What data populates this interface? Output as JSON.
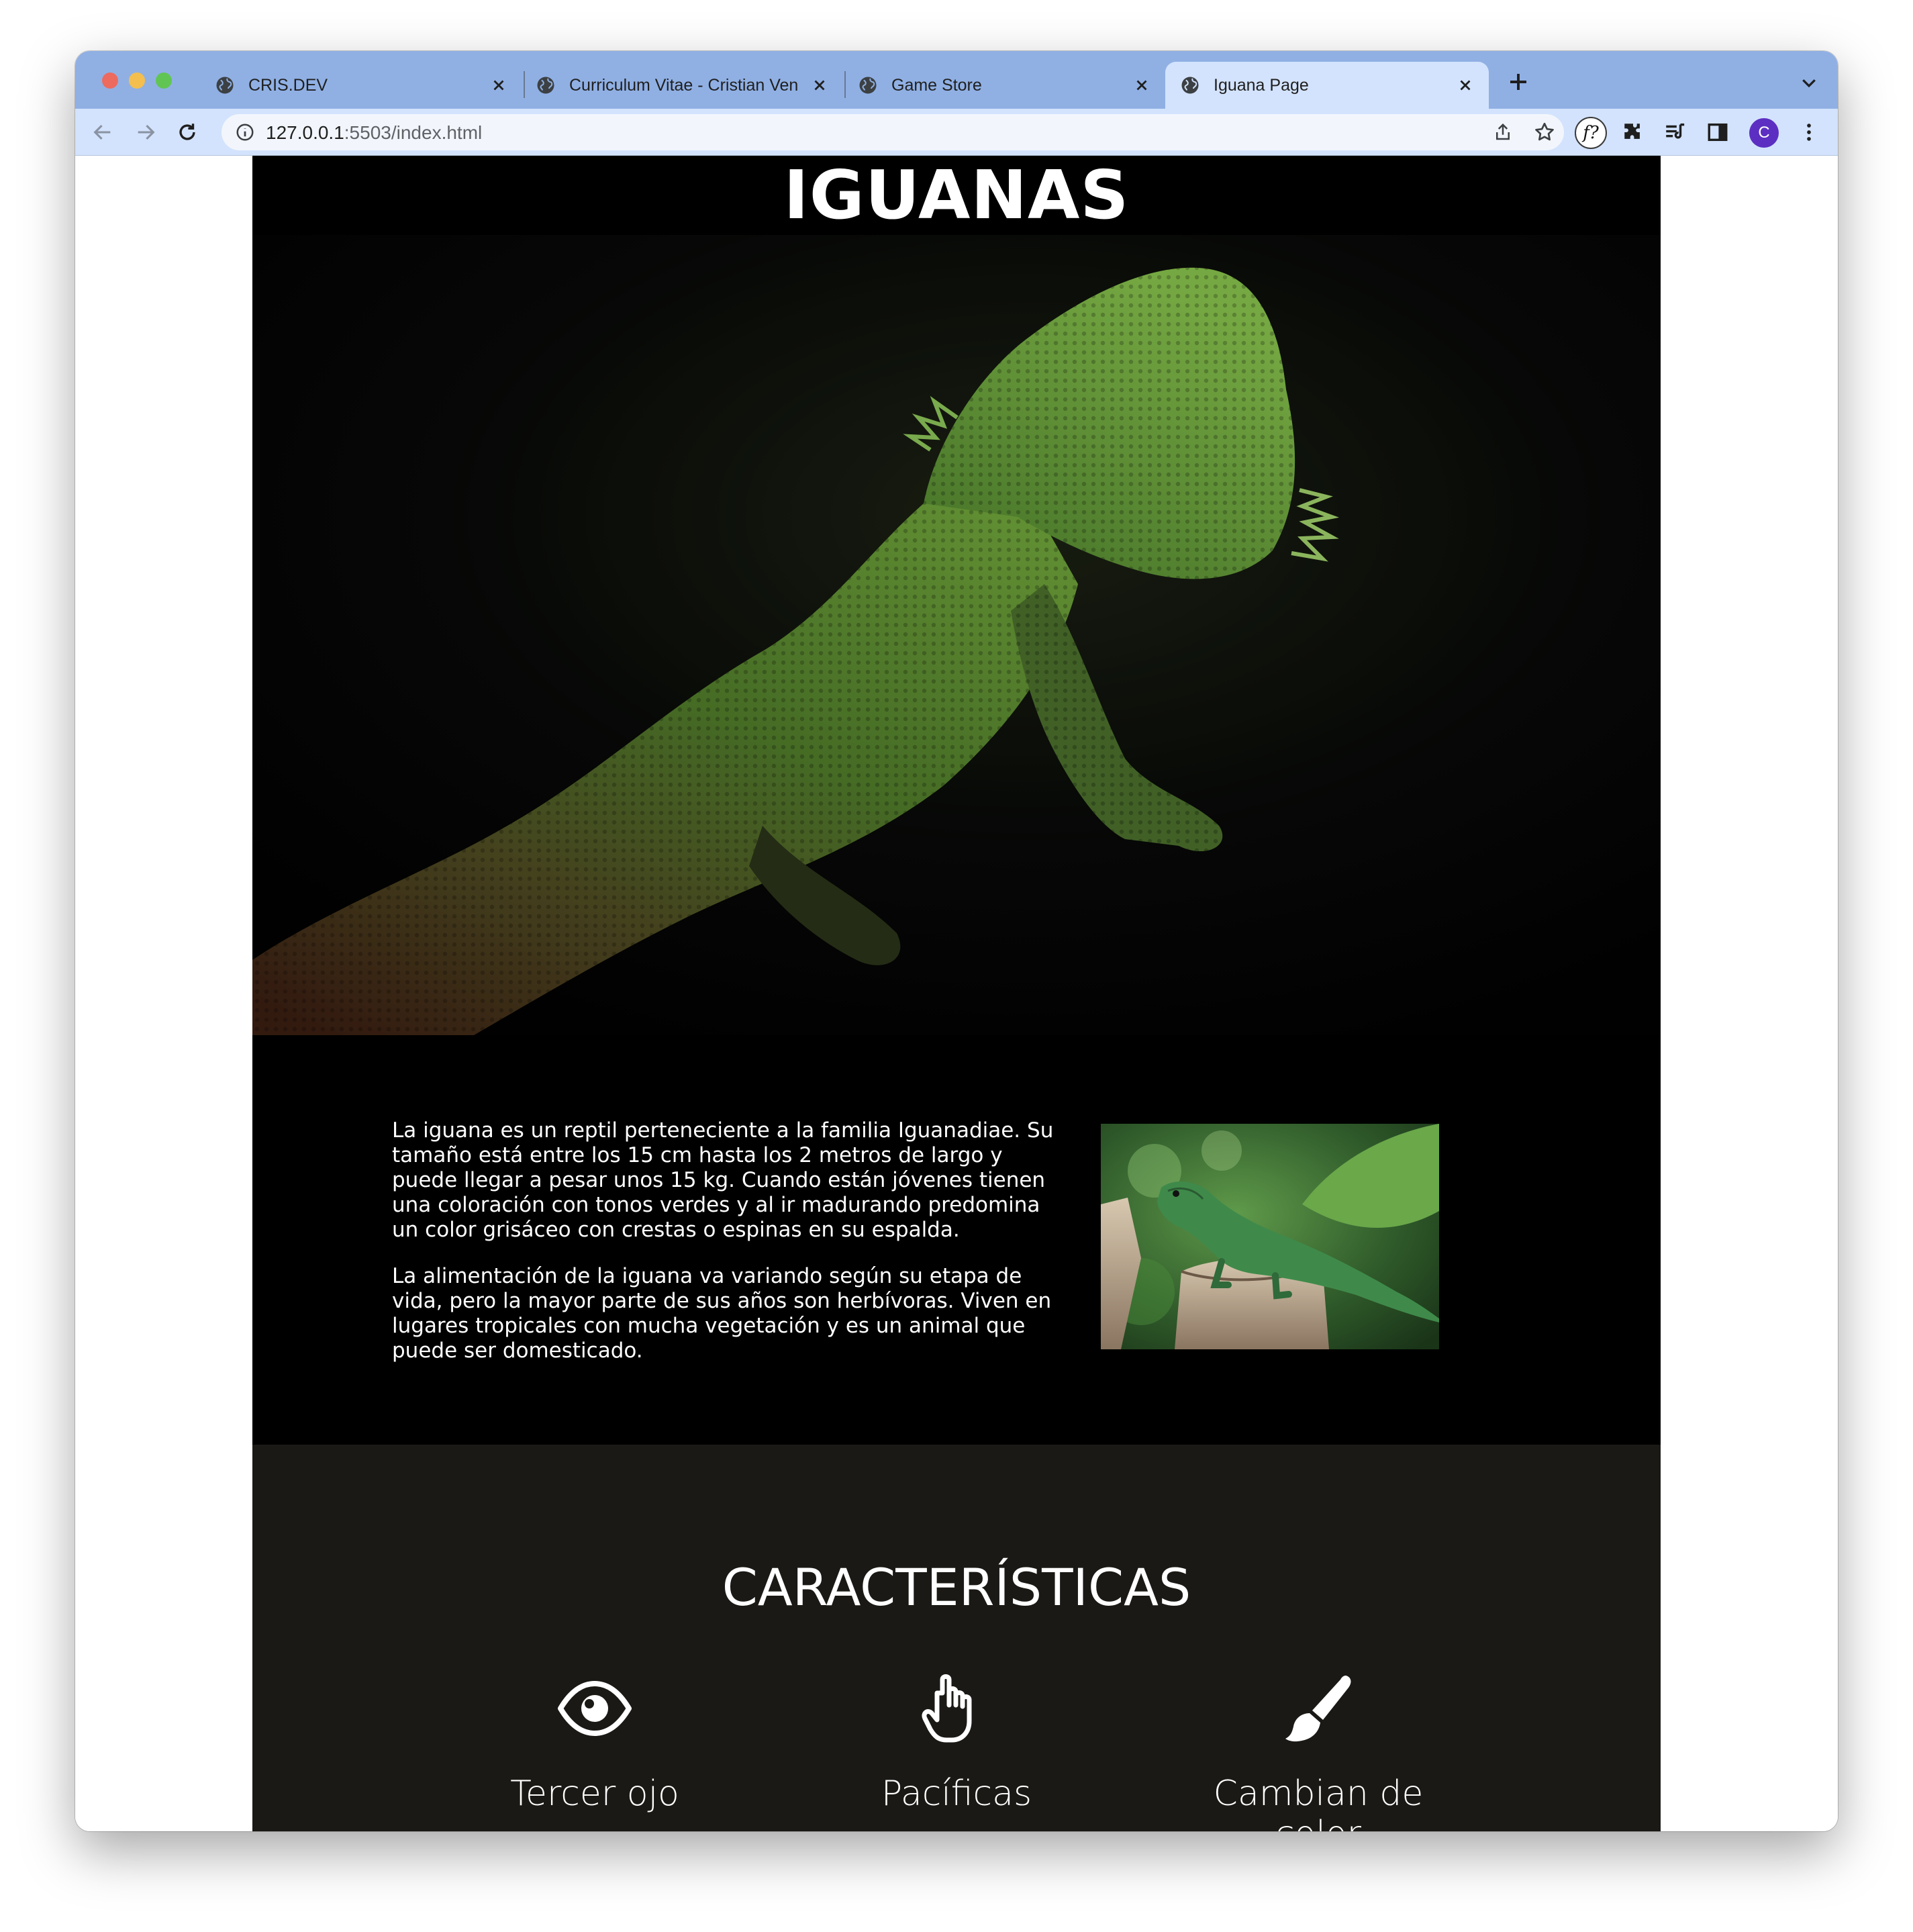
{
  "browser": {
    "tabs": [
      {
        "title": "CRIS.DEV",
        "active": false
      },
      {
        "title": "Curriculum Vitae - Cristian Ven",
        "active": false
      },
      {
        "title": "Game Store",
        "active": false
      },
      {
        "title": "Iguana Page",
        "active": true
      }
    ],
    "url_host": "127.0.0.1",
    "url_path": ":5503/index.html",
    "extension_label": "f?",
    "avatar_letter": "C",
    "colors": {
      "tabstrip": "#90b0e4",
      "toolbar": "#d3e3fd",
      "avatar": "#5c2fc2"
    }
  },
  "page": {
    "title": "IGUANAS",
    "hero_image": "bearded-dragon-photo",
    "paragraphs": [
      "La iguana es un reptil perteneciente a la familia Iguanadiae. Su tamaño está entre los 15 cm hasta los 2 metros de largo y puede llegar a pesar unos 15 kg. Cuando están jóvenes tienen una coloración con tonos verdes y al ir madurando predomina un color grisáceo con crestas o espinas en su espalda.",
      "La alimentación de la iguana va variando según su etapa de vida, pero la mayor parte de sus años son herbívoras. Viven en lugares tropicales con mucha vegetación y es un animal que puede ser domesticado."
    ],
    "side_image": "green-iguana-on-stump-photo",
    "features_title": "CARACTERÍSTICAS",
    "features": [
      {
        "icon": "eye-icon",
        "label": "Tercer ojo"
      },
      {
        "icon": "hand-pointer-icon",
        "label": "Pacíficas"
      },
      {
        "icon": "paint-brush-icon",
        "label": "Cambian de color"
      }
    ],
    "colors": {
      "background": "#000000",
      "features_background": "#1b1915",
      "text": "#ffffff"
    }
  }
}
